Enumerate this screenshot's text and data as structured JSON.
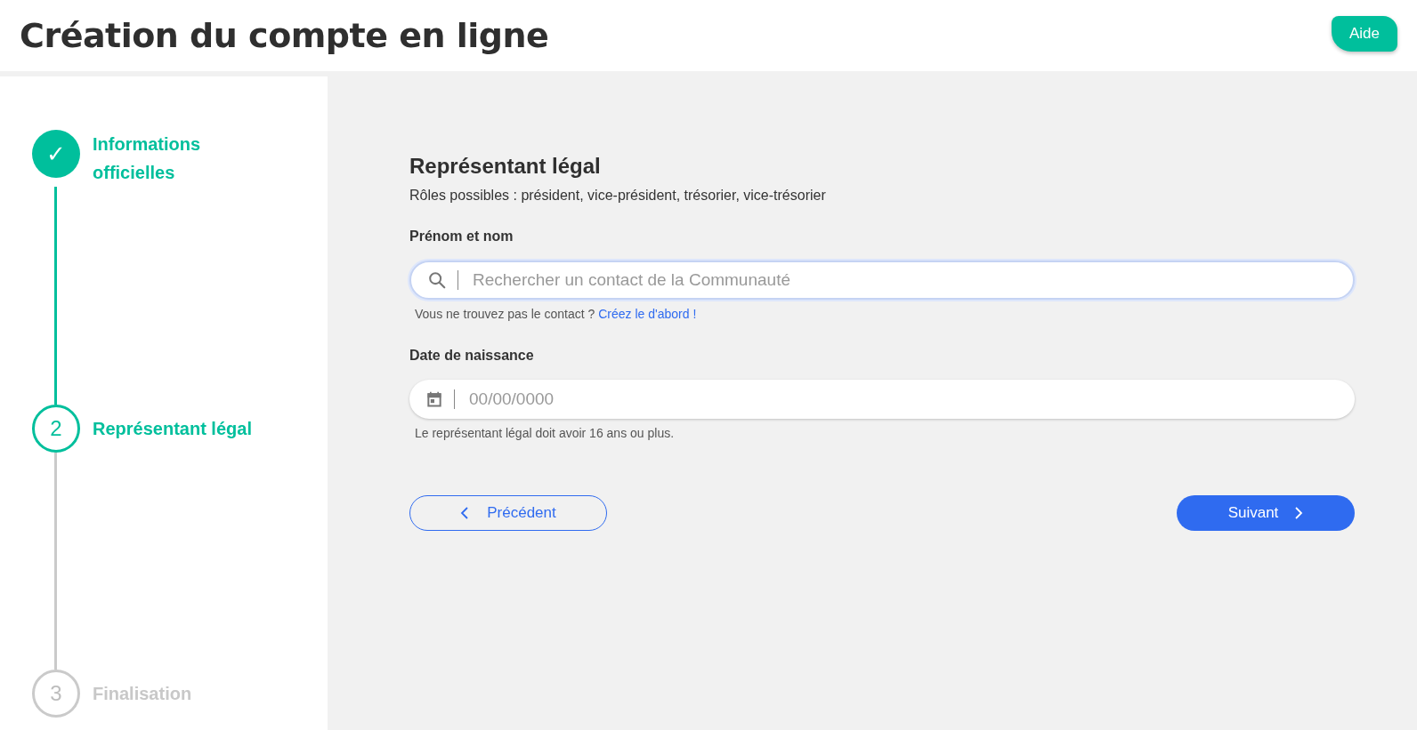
{
  "header": {
    "title": "Création du compte en ligne",
    "help_button": "Aide"
  },
  "steps": [
    {
      "marker": "✓",
      "label": "Informations officielles",
      "kind": "done"
    },
    {
      "marker": "2",
      "label": "Représentant légal",
      "kind": "current"
    },
    {
      "marker": "3",
      "label": "Finalisation",
      "kind": "pending"
    }
  ],
  "form": {
    "title": "Représentant légal",
    "subtitle": "Rôles possibles : président, vice-président, trésorier, vice-trésorier",
    "name_field": {
      "label": "Prénom et nom",
      "placeholder": "Rechercher un contact de la Communauté",
      "focused": true,
      "hint": "Vous ne trouvez pas le contact ?",
      "hint_link": "Créez le d'abord !"
    },
    "date_field": {
      "label": "Date de naissance",
      "placeholder": "00/00/0000",
      "hint": "Le représentant légal doit avoir 16 ans ou plus."
    },
    "back_button": "Précédent",
    "next_button": "Suivant"
  }
}
